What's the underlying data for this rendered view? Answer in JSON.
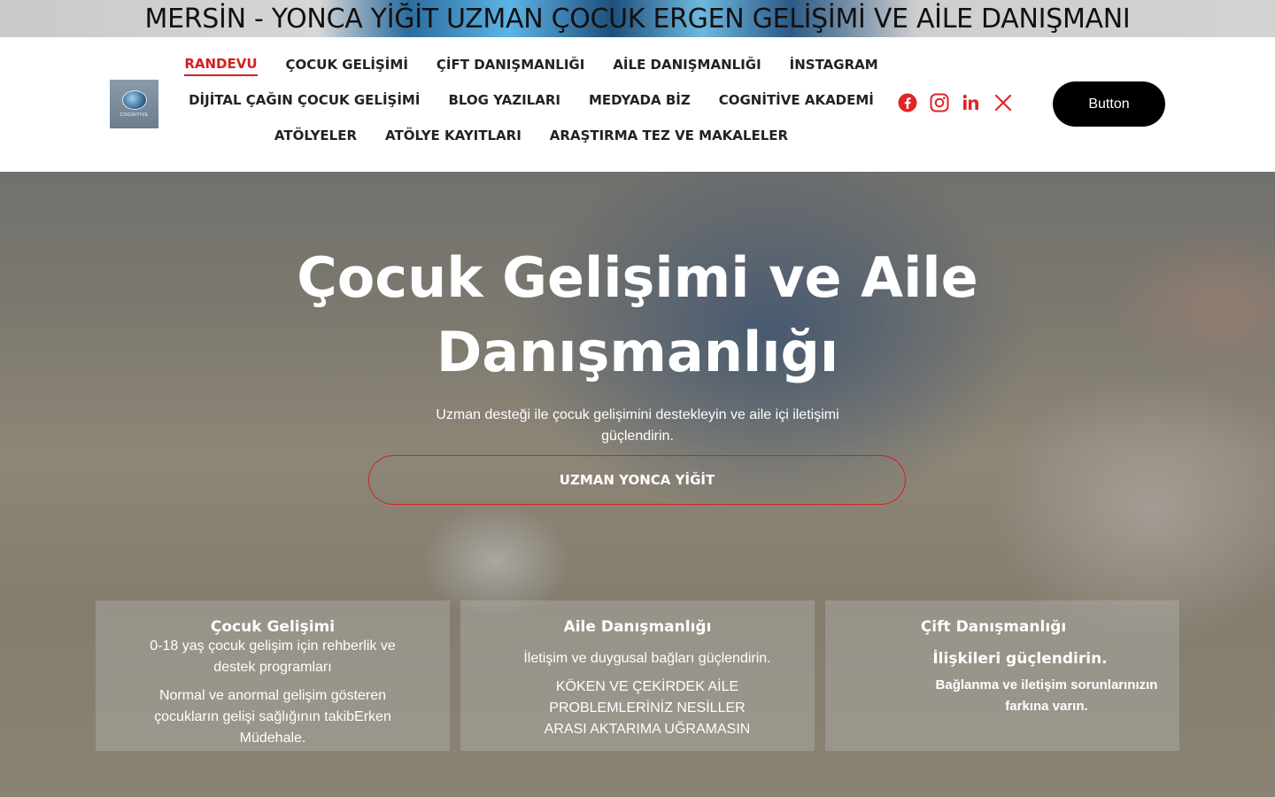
{
  "banner": {
    "title": "MERSİN - YONCA YİĞİT UZMAN ÇOCUK ERGEN GELİŞİMİ VE AİLE DANIŞMANI"
  },
  "logo": {
    "text": "COGNITIVE"
  },
  "nav": {
    "row1": [
      "RANDEVU",
      "ÇOCUK GELİŞİMİ",
      "ÇİFT DANIŞMANLIĞI",
      "AİLE DANIŞMANLIĞI",
      "İNSTAGRAM"
    ],
    "row2": [
      "DİJİTAL ÇAĞIN ÇOCUK GELİŞİMİ",
      "BLOG  YAZILARI",
      "MEDYADA BİZ",
      "COGNİTİVE AKADEMİ"
    ],
    "row3": [
      "ATÖLYELER",
      "ATÖLYE KAYITLARI",
      "ARAŞTIRMA TEZ VE MAKALELER"
    ],
    "active": "RANDEVU"
  },
  "social": [
    "facebook-icon",
    "instagram-icon",
    "linkedin-icon",
    "x-icon"
  ],
  "cta": {
    "label": "Button"
  },
  "hero": {
    "title_line1": "Çocuk Gelişimi ve Aile",
    "title_line2": "Danışmanlığı",
    "subtitle": "Uzman desteği ile çocuk gelişimini destekleyin ve aile içi iletişimi güçlendirin.",
    "button": "UZMAN YONCA YİĞİT"
  },
  "cards": [
    {
      "title": "Çocuk Gelişimi",
      "line1": "0-18 yaş çocuk gelişim için rehberlik ve destek programları",
      "line2": "Normal ve anormal gelişim gösteren çocukların gelişi  sağlığının takibErken Müdehale."
    },
    {
      "title": "Aile Danışmanlığı",
      "line1": "İletişim ve duygusal bağları güçlendirin.",
      "line2": "KÖKEN VE ÇEKİRDEK AİLE PROBLEMLERİNİZ NESİLLER ARASI AKTARIMA UĞRAMASIN"
    },
    {
      "title": "Çift Danışmanlığı",
      "line1": "İlişkileri güçlendirin.",
      "line2": "Bağlanma ve iletişim  sorunlarınızın farkına varın."
    }
  ],
  "colors": {
    "accent": "#d42020",
    "facebook": "#e02525",
    "button_bg": "#000000"
  }
}
